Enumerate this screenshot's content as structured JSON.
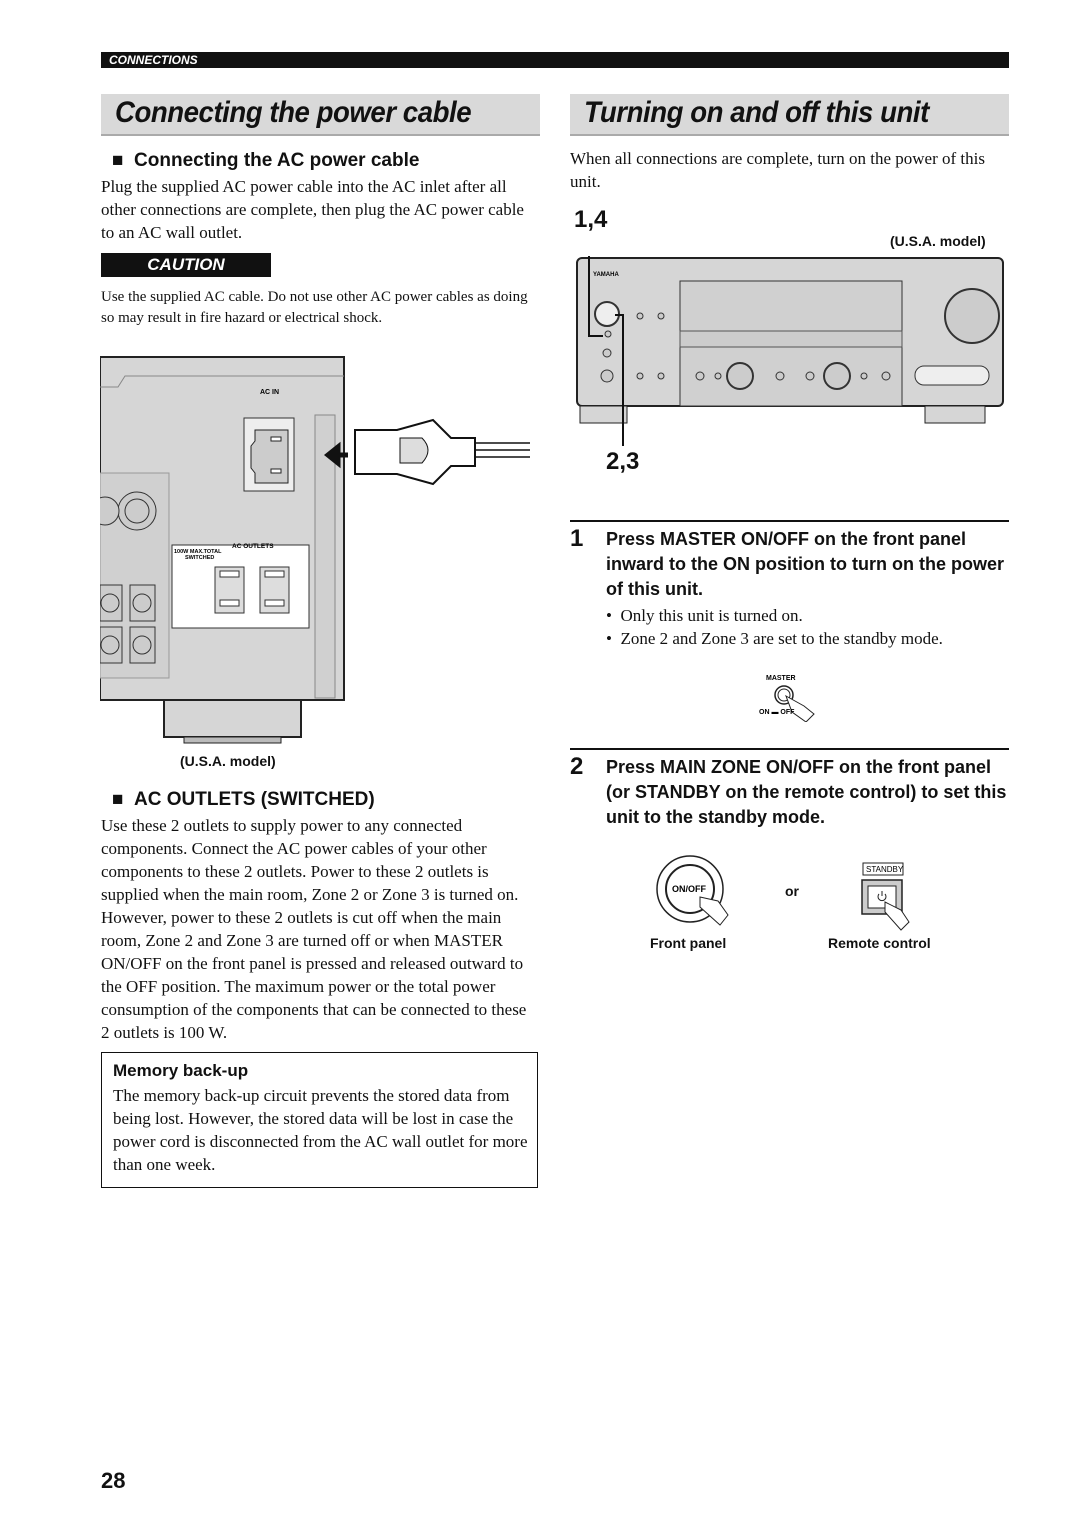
{
  "header": {
    "section": "CONNECTIONS"
  },
  "left": {
    "title": "Connecting the power cable",
    "sub1": "Connecting the AC power cable",
    "para1": "Plug the supplied AC power cable into the AC inlet after all other connections are complete, then plug the AC power cable to an AC wall outlet.",
    "caution_label": "CAUTION",
    "caution_text": "Use the supplied AC cable. Do not use other AC power cables as doing so may result in fire hazard or electrical shock.",
    "figure": {
      "ac_in": "AC IN",
      "ac_outlets": "AC OUTLETS",
      "max_total": "100W MAX.TOTAL",
      "switched": "SWITCHED",
      "caption": "(U.S.A. model)"
    },
    "sub2": "AC OUTLETS (SWITCHED)",
    "para2": "Use these 2 outlets to supply power to any connected components. Connect the AC power cables of your other components to these 2 outlets. Power to these 2 outlets is supplied when the main room, Zone 2 or Zone 3 is turned on. However, power to these 2 outlets is cut off when the main room, Zone 2 and Zone 3 are turned off or when MASTER ON/OFF on the front panel is pressed and released outward to the OFF position. The maximum power or the total power consumption of the components that can be connected to these 2 outlets is 100 W.",
    "memo_title": "Memory back-up",
    "memo_text": "The memory back-up circuit prevents the stored data from being lost. However, the stored data will be lost in case the power cord is disconnected from the AC wall outlet for more than one week."
  },
  "right": {
    "title": "Turning on and off this unit",
    "intro": "When all connections are complete, turn on the power of this unit.",
    "figure": {
      "callout_top": "1,4",
      "callout_bottom": "2,3",
      "caption": "(U.S.A. model)",
      "brand": "YAMAHA"
    },
    "step1": {
      "num": "1",
      "text": "Press MASTER ON/OFF on the front panel inward to the ON position to turn on the power of this unit.",
      "bullets": [
        "Only this unit is turned on.",
        "Zone 2 and Zone 3 are set to the standby mode."
      ],
      "fig_master": "MASTER",
      "fig_onoff": "ON ▬ OFF"
    },
    "step2": {
      "num": "2",
      "text": "Press MAIN ZONE ON/OFF on the front panel (or STANDBY on the remote control) to set this unit to the standby mode.",
      "btn_onoff": "ON/OFF",
      "or": "or",
      "standby": "STANDBY",
      "cap_front": "Front panel",
      "cap_remote": "Remote control"
    }
  },
  "page_number": "28"
}
